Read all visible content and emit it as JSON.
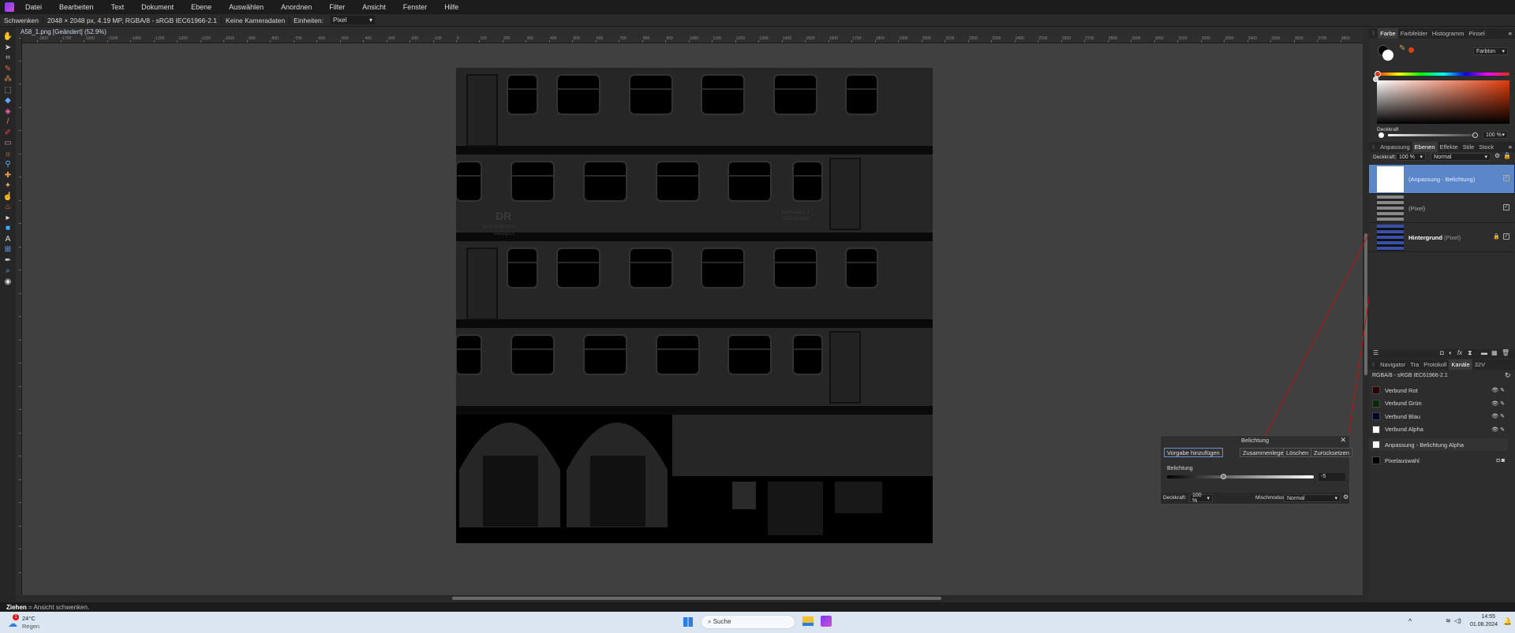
{
  "menu": [
    "Datei",
    "Bearbeiten",
    "Text",
    "Dokument",
    "Ebene",
    "Auswählen",
    "Anordnen",
    "Filter",
    "Ansicht",
    "Fenster",
    "Hilfe"
  ],
  "context": {
    "tool": "Schwenken",
    "info": "2048 × 2048 px, 4.19 MP, RGBA/8 - sRGB IEC61966-2.1",
    "camera": "Keine Kameradaten",
    "units_label": "Einheiten:",
    "units_value": "Pixel"
  },
  "document_tab": "A58_1.png [Geändert] (52.9%)",
  "tools": [
    "hand-icon",
    "move-icon",
    "crop-icon",
    "selection-brush-icon",
    "flood-select-icon",
    "marquee-icon",
    "fill-icon",
    "gradient-icon",
    "paint-brush-icon",
    "color-replace-icon",
    "erase-icon",
    "dodge-icon",
    "clone-icon",
    "healing-icon",
    "blemish-icon",
    "smudge-icon",
    "burn-icon",
    "node-icon",
    "rectangle-icon",
    "text-icon",
    "zoom-icon",
    "pen-icon",
    "color-picker-icon",
    "shape-icon"
  ],
  "ruler": {
    "start": -1800,
    "end": 3900,
    "step": 100
  },
  "image": {
    "logo": "DR",
    "number": "60 80 99-08 101-6",
    "label_small": "Meßwagen 2",
    "label1": "Meßwagen 2",
    "label2": "VES-M Halle"
  },
  "color_panel": {
    "tabs": [
      "Farbe",
      "Farbfelder",
      "Histogramm",
      "Pinsel"
    ],
    "mode": "Farbton",
    "opacity_label": "Deckkraft",
    "opacity_value": "100 %",
    "accent": "#e04010"
  },
  "layers_panel": {
    "tabs": [
      "Anpassung",
      "Ebenen",
      "Effekte",
      "Stile",
      "Stock"
    ],
    "opacity_label": "Deckkraft:",
    "opacity_value": "100 %",
    "blend": "Normal",
    "layers": [
      {
        "name": "(Anpassung - Belichtung)",
        "selected": true
      },
      {
        "name": "(Pixel)"
      },
      {
        "name": "Hintergrund",
        "type": "(Pixel)",
        "locked": true
      }
    ]
  },
  "channels_panel": {
    "tabs": [
      "Navigator",
      "Tra",
      "Protokoll",
      "Kanäle",
      "32V"
    ],
    "profile": "RGBA/8 - sRGB IEC61966-2.1",
    "channels": [
      {
        "name": "Verbund Rot",
        "color": "#2a0606"
      },
      {
        "name": "Verbund Grün",
        "color": "#062a06"
      },
      {
        "name": "Verbund Blau",
        "color": "#06062a"
      },
      {
        "name": "Verbund Alpha",
        "color": "#ffffff"
      }
    ],
    "adjust_alpha": "Anpassung - Belichtung Alpha",
    "pixel_selection": "Pixelauswahl"
  },
  "dialog": {
    "title": "Belichtung",
    "preset": "Vorgabe hinzufügen",
    "merge": "Zusammenlegen",
    "delete": "Löschen",
    "reset": "Zurücksetzen",
    "param_label": "Belichtung",
    "value": "-5",
    "slider_fraction": 0.38,
    "opacity_label": "Deckkraft:",
    "opacity_value": "100 %",
    "blend_label": "Mischmodus:",
    "blend_value": "Normal"
  },
  "status": {
    "key": "Ziehen",
    "text": " = Ansicht schwenken."
  },
  "taskbar": {
    "temp": "24°C",
    "weather": "Regen",
    "badge": "1",
    "search": "Suche",
    "time": "14:55",
    "date": "01.08.2024"
  }
}
